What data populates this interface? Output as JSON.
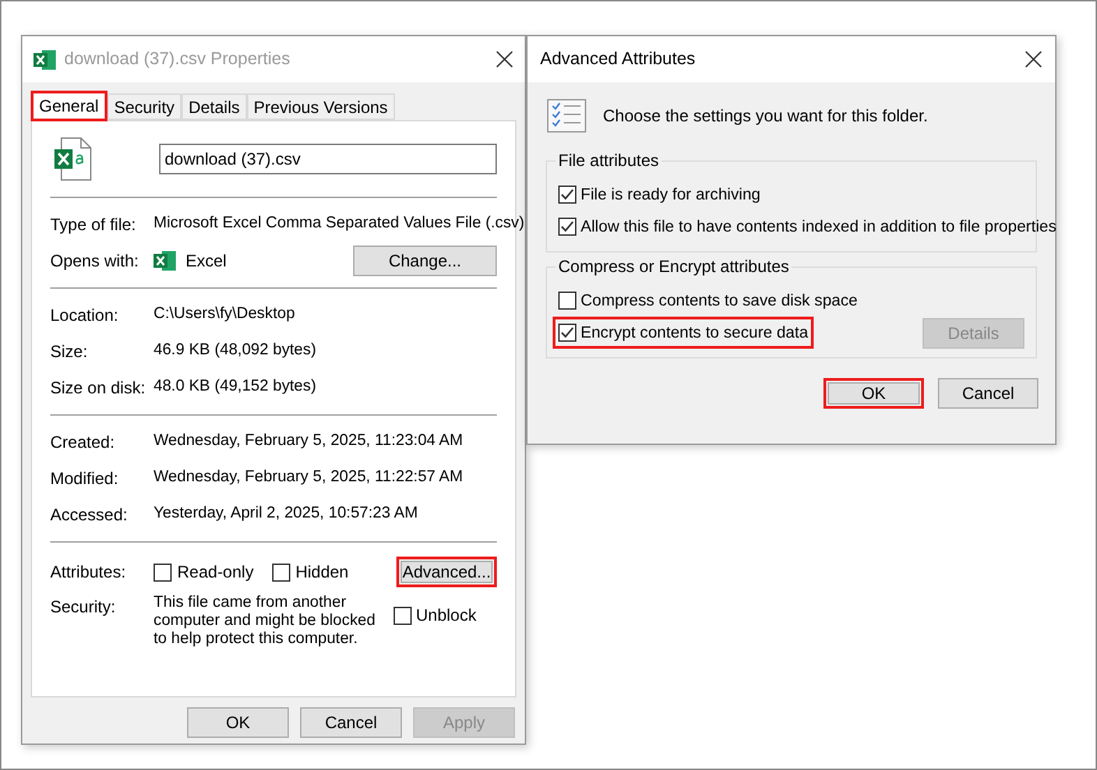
{
  "properties_window": {
    "title": "download (37).csv Properties",
    "tabs": [
      {
        "label": "General",
        "selected": true,
        "highlighted": true
      },
      {
        "label": "Security",
        "selected": false,
        "highlighted": false
      },
      {
        "label": "Details",
        "selected": false,
        "highlighted": false
      },
      {
        "label": "Previous Versions",
        "selected": false,
        "highlighted": false
      }
    ],
    "file_name": {
      "value": "download (37).csv"
    },
    "info_groups": [
      [
        {
          "kind": "text",
          "label": "Type of file:",
          "value": "Microsoft Excel Comma Separated Values File (.csv)"
        },
        {
          "kind": "app",
          "label": "Opens with:",
          "value": "Excel",
          "button": "Change..."
        }
      ],
      [
        {
          "kind": "text",
          "label": "Location:",
          "value": "C:\\Users\\fy\\Desktop"
        },
        {
          "kind": "text",
          "label": "Size:",
          "value": "46.9 KB (48,092 bytes)"
        },
        {
          "kind": "text",
          "label": "Size on disk:",
          "value": "48.0 KB (49,152 bytes)"
        }
      ],
      [
        {
          "kind": "text",
          "label": "Created:",
          "value": "Wednesday, February 5, 2025, 11:23:04 AM"
        },
        {
          "kind": "text",
          "label": "Modified:",
          "value": "Wednesday, February 5, 2025, 11:22:57 AM"
        },
        {
          "kind": "text",
          "label": "Accessed:",
          "value": "Yesterday, April 2, 2025, 10:57:23 AM"
        }
      ]
    ],
    "attributes": {
      "label": "Attributes:",
      "checkboxes": [
        {
          "label": "Read-only",
          "checked": false
        },
        {
          "label": "Hidden",
          "checked": false
        }
      ],
      "advanced_button": {
        "label": "Advanced...",
        "highlighted": true
      }
    },
    "security": {
      "label": "Security:",
      "text": "This file came from another computer and might be blocked to help protect this computer.",
      "unblock": {
        "label": "Unblock",
        "checked": false
      }
    },
    "buttons": [
      {
        "label": "OK",
        "disabled": false
      },
      {
        "label": "Cancel",
        "disabled": false
      },
      {
        "label": "Apply",
        "disabled": true
      }
    ]
  },
  "advanced_window": {
    "title": "Advanced Attributes",
    "description": "Choose the settings you want for this folder.",
    "groups": [
      {
        "title": "File attributes",
        "checkboxes": [
          {
            "label": "File is ready for archiving",
            "checked": true,
            "highlighted": false
          },
          {
            "label": "Allow this file to have contents indexed in addition to file properties",
            "checked": true,
            "highlighted": false
          }
        ]
      },
      {
        "title": "Compress or Encrypt attributes",
        "checkboxes": [
          {
            "label": "Compress contents to save disk space",
            "checked": false,
            "highlighted": false
          },
          {
            "label": "Encrypt contents to secure data",
            "checked": true,
            "highlighted": true
          }
        ],
        "details_button": {
          "label": "Details",
          "disabled": true
        }
      }
    ],
    "buttons": [
      {
        "label": "OK",
        "highlighted": true
      },
      {
        "label": "Cancel",
        "highlighted": false
      }
    ]
  }
}
